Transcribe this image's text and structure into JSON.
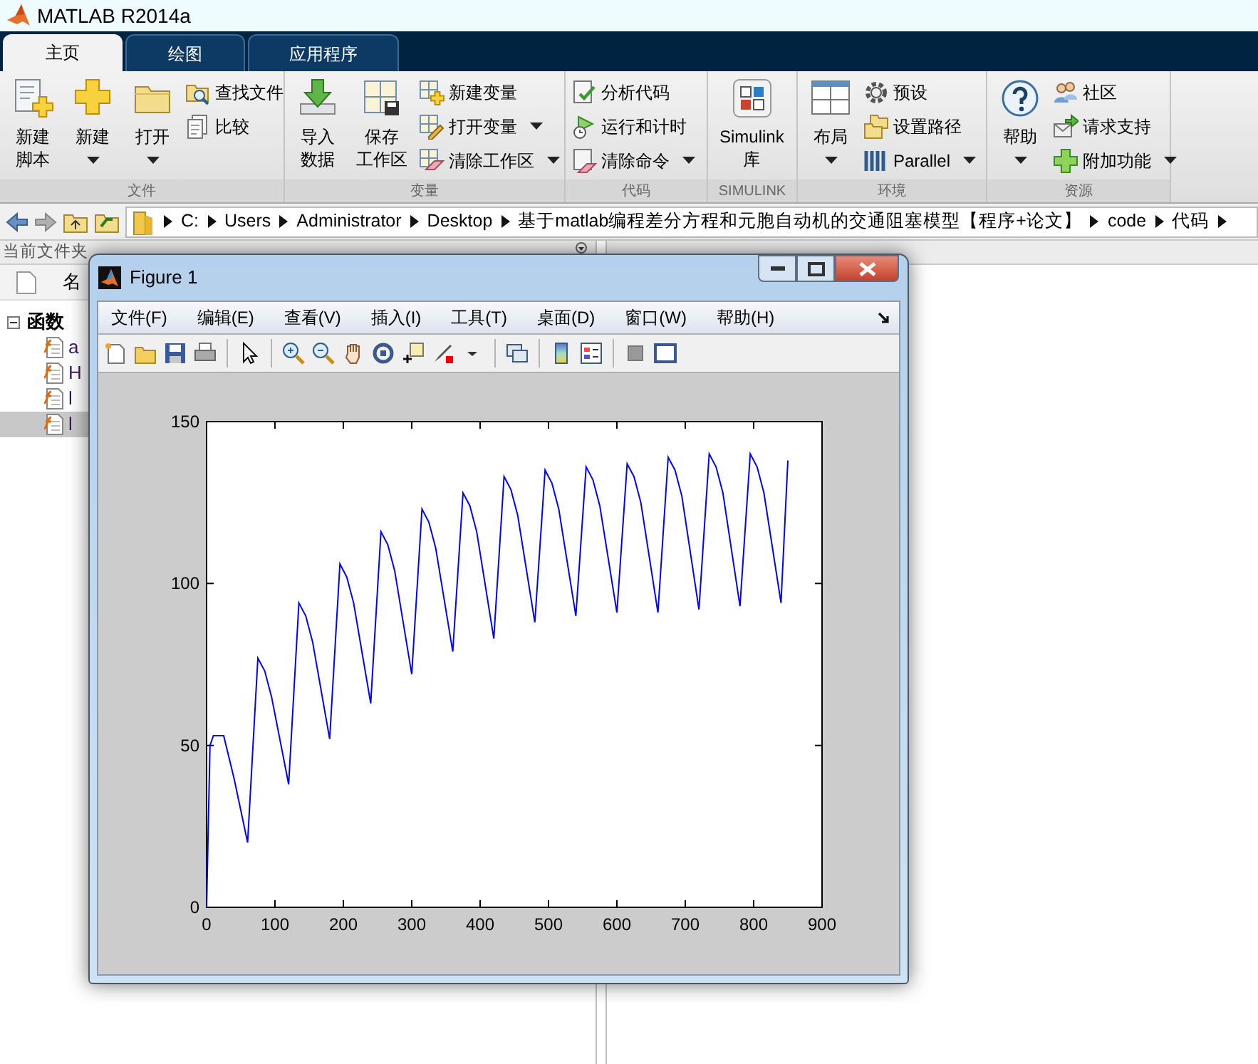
{
  "window": {
    "title": "MATLAB R2014a"
  },
  "tabs": [
    {
      "label": "主页",
      "selected": true
    },
    {
      "label": "绘图",
      "selected": false
    },
    {
      "label": "应用程序",
      "selected": false
    }
  ],
  "ribbon": {
    "groups": [
      {
        "label": "文件",
        "items": [
          {
            "kind": "large",
            "lines": [
              "新建",
              "脚本"
            ],
            "menu": false
          },
          {
            "kind": "large",
            "lines": [
              "新建"
            ],
            "menu": true
          },
          {
            "kind": "large",
            "lines": [
              "打开"
            ],
            "menu": true
          },
          {
            "kind": "column",
            "items": [
              {
                "label": "查找文件",
                "menu": false
              },
              {
                "label": "比较",
                "menu": false
              }
            ]
          }
        ]
      },
      {
        "label": "变量",
        "items": [
          {
            "kind": "large",
            "lines": [
              "导入",
              "数据"
            ],
            "menu": false
          },
          {
            "kind": "large",
            "lines": [
              "保存",
              "工作区"
            ],
            "menu": false
          },
          {
            "kind": "column",
            "items": [
              {
                "label": "新建变量",
                "menu": false
              },
              {
                "label": "打开变量",
                "menu": true
              },
              {
                "label": "清除工作区",
                "menu": true
              }
            ]
          }
        ]
      },
      {
        "label": "代码",
        "items": [
          {
            "kind": "column",
            "items": [
              {
                "label": "分析代码",
                "menu": false
              },
              {
                "label": "运行和计时",
                "menu": false
              },
              {
                "label": "清除命令",
                "menu": true
              }
            ]
          }
        ]
      },
      {
        "label": "SIMULINK",
        "items": [
          {
            "kind": "large",
            "lines": [
              "Simulink",
              "库"
            ],
            "menu": false
          }
        ]
      },
      {
        "label": "环境",
        "items": [
          {
            "kind": "large",
            "lines": [
              "布局"
            ],
            "menu": true
          },
          {
            "kind": "column",
            "items": [
              {
                "label": "预设",
                "menu": false
              },
              {
                "label": "设置路径",
                "menu": false
              },
              {
                "label": "Parallel",
                "menu": true
              }
            ]
          }
        ]
      },
      {
        "label": "资源",
        "items": [
          {
            "kind": "large",
            "lines": [
              "帮助"
            ],
            "menu": true
          },
          {
            "kind": "column",
            "items": [
              {
                "label": "社区",
                "menu": false
              },
              {
                "label": "请求支持",
                "menu": false
              },
              {
                "label": "附加功能",
                "menu": true
              }
            ]
          }
        ]
      }
    ]
  },
  "address_bar": {
    "path": [
      "C:",
      "Users",
      "Administrator",
      "Desktop",
      "基于matlab编程差分方程和元胞自动机的交通阻塞模型【程序+论文】",
      "code",
      "代码"
    ]
  },
  "current_folder": {
    "title": "当前文件夹",
    "column_header": "名",
    "tree": [
      {
        "label": "函数",
        "expanded": true,
        "children": [
          {
            "name": "a",
            "selected": false
          },
          {
            "name": "H",
            "selected": false
          },
          {
            "name": "l",
            "selected": false
          },
          {
            "name": "l",
            "selected": true
          }
        ]
      }
    ]
  },
  "figure": {
    "title": "Figure 1",
    "menus": [
      "文件(F)",
      "编辑(E)",
      "查看(V)",
      "插入(I)",
      "工具(T)",
      "桌面(D)",
      "窗口(W)",
      "帮助(H)"
    ],
    "chart_data": {
      "type": "line",
      "x": [
        0,
        5,
        10,
        25,
        40,
        60,
        75,
        85,
        95,
        120,
        135,
        145,
        155,
        180,
        195,
        205,
        215,
        240,
        255,
        265,
        275,
        300,
        315,
        325,
        335,
        360,
        375,
        385,
        395,
        420,
        435,
        445,
        455,
        480,
        495,
        505,
        515,
        540,
        555,
        565,
        575,
        600,
        615,
        625,
        635,
        660,
        675,
        685,
        695,
        720,
        735,
        745,
        755,
        780,
        795,
        805,
        815,
        840,
        850
      ],
      "series": [
        {
          "color": "#0000ff",
          "values": [
            0,
            50,
            53,
            53,
            40,
            20,
            77,
            73,
            65,
            38,
            94,
            90,
            82,
            52,
            106,
            102,
            94,
            63,
            116,
            112,
            104,
            72,
            123,
            119,
            111,
            79,
            128,
            124,
            116,
            83,
            133,
            129,
            121,
            88,
            135,
            131,
            123,
            90,
            136,
            132,
            124,
            91,
            137,
            133,
            125,
            91,
            139,
            135,
            127,
            92,
            140,
            136,
            128,
            93,
            140,
            136,
            128,
            94,
            138
          ]
        }
      ],
      "xlim": [
        0,
        900
      ],
      "ylim": [
        0,
        150
      ],
      "xticks": [
        0,
        100,
        200,
        300,
        400,
        500,
        600,
        700,
        800,
        900
      ],
      "yticks": [
        0,
        50,
        100,
        150
      ]
    }
  }
}
